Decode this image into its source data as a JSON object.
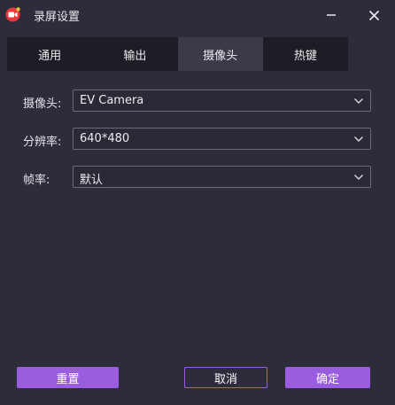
{
  "window": {
    "title": "录屏设置"
  },
  "icons": {
    "app": "screen-recorder-app-icon",
    "minimize": "minimize-icon",
    "close": "close-icon",
    "chevron": "chevron-down-icon"
  },
  "tabs": [
    {
      "label": "通用",
      "active": false
    },
    {
      "label": "输出",
      "active": false
    },
    {
      "label": "摄像头",
      "active": true
    },
    {
      "label": "热键",
      "active": false
    }
  ],
  "form": {
    "camera": {
      "label": "摄像头:",
      "value": "EV Camera"
    },
    "resolution": {
      "label": "分辨率:",
      "value": "640*480"
    },
    "framerate": {
      "label": "帧率:",
      "value": "默认"
    }
  },
  "buttons": {
    "reset": "重置",
    "cancel": "取消",
    "ok": "确定"
  },
  "colors": {
    "background": "#2d2c3a",
    "tabbar": "#1d1d25",
    "tab_active": "#3b3a48",
    "accent": "#9b5de0",
    "select_border": "#6b6a78"
  }
}
